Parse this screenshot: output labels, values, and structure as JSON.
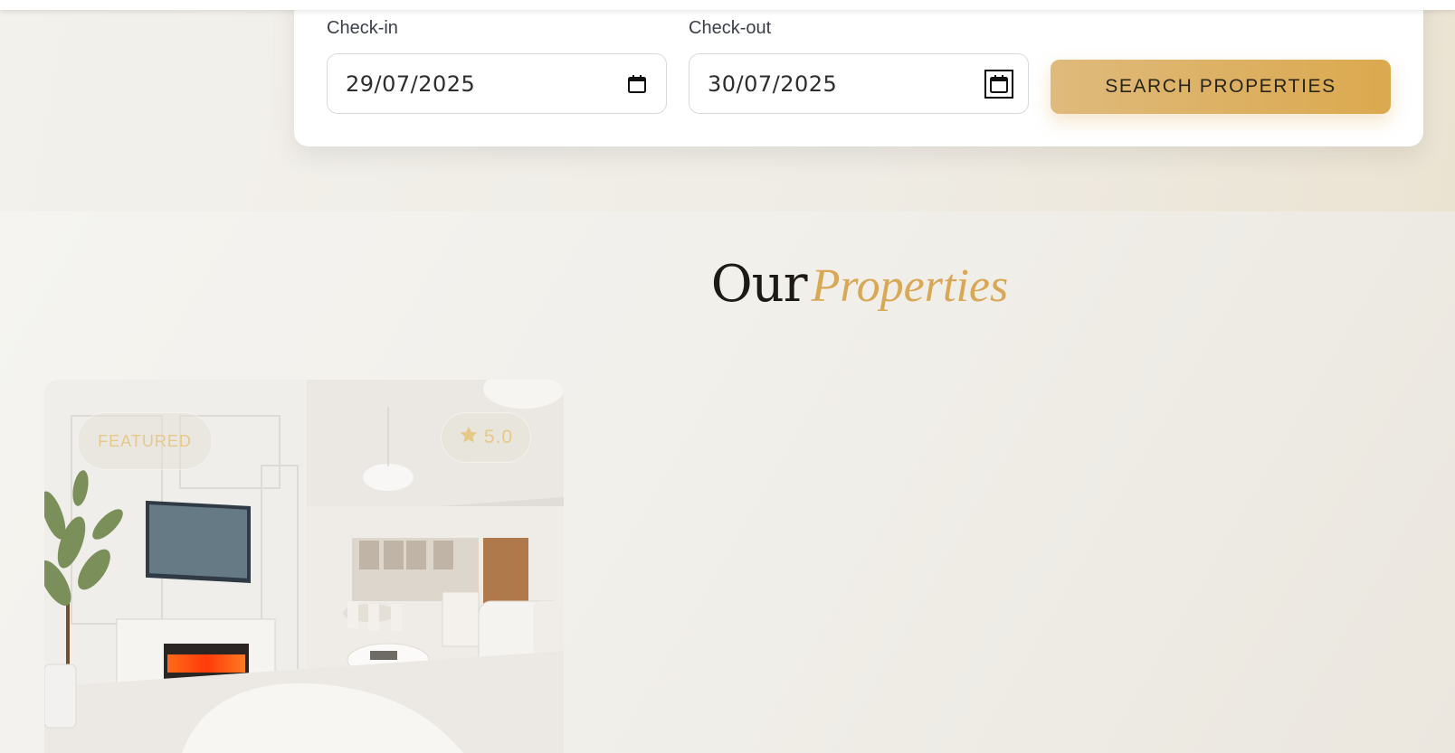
{
  "search_form": {
    "checkin_label": "Check-in",
    "checkin_value": "29/07/2025",
    "checkout_label": "Check-out",
    "checkout_value": "30/07/2025",
    "search_button_label": "SEARCH PROPERTIES"
  },
  "properties": {
    "title_main": "Our",
    "title_accent": "Properties",
    "cards": [
      {
        "badge_featured": "FEATURED",
        "rating": "5.0"
      }
    ]
  },
  "colors": {
    "accent_gold": "#d8a856",
    "button_gradient_start": "#dfba7c",
    "button_gradient_end": "#dba94e"
  }
}
